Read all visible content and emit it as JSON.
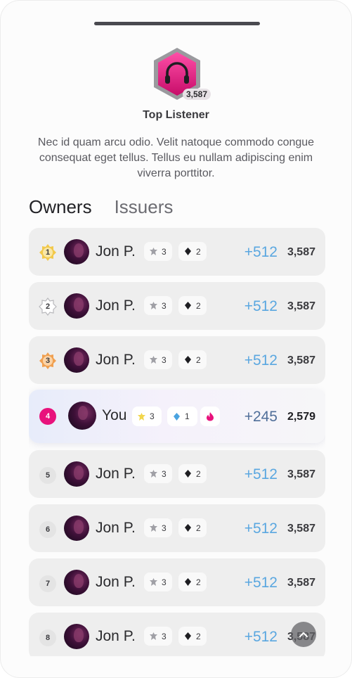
{
  "badge": {
    "title": "Top Listener",
    "count": "3,587",
    "icon": "headphones-icon",
    "color": "#e8127c",
    "description": "Nec id quam arcu odio. Velit natoque commodo congue consequat eget tellus. Tellus eu nullam adipiscing enim viverra porttitor."
  },
  "tabs": [
    {
      "label": "Owners",
      "active": true
    },
    {
      "label": "Issuers",
      "active": false
    }
  ],
  "rows": [
    {
      "rank": "1",
      "name": "Jon P.",
      "stat1": "3",
      "stat2": "2",
      "gain": "+512",
      "score": "3,587",
      "medal": "gold"
    },
    {
      "rank": "2",
      "name": "Jon P.",
      "stat1": "3",
      "stat2": "2",
      "gain": "+512",
      "score": "3,587",
      "medal": "silver"
    },
    {
      "rank": "3",
      "name": "Jon P.",
      "stat1": "3",
      "stat2": "2",
      "gain": "+512",
      "score": "3,587",
      "medal": "bronze"
    },
    {
      "rank": "4",
      "name": "You",
      "stat1": "3",
      "stat2": "1",
      "gain": "+245",
      "score": "2,579",
      "is_me": true
    },
    {
      "rank": "5",
      "name": "Jon P.",
      "stat1": "3",
      "stat2": "2",
      "gain": "+512",
      "score": "3,587"
    },
    {
      "rank": "6",
      "name": "Jon P.",
      "stat1": "3",
      "stat2": "2",
      "gain": "+512",
      "score": "3,587"
    },
    {
      "rank": "7",
      "name": "Jon P.",
      "stat1": "3",
      "stat2": "2",
      "gain": "+512",
      "score": "3,587"
    },
    {
      "rank": "8",
      "name": "Jon P.",
      "stat1": "3",
      "stat2": "2",
      "gain": "+512",
      "score": "3,587"
    }
  ],
  "colors": {
    "accent": "#e8127c",
    "gain": "#5aa7e0",
    "gold": "#f2c94c",
    "bronze": "#f0a050"
  }
}
